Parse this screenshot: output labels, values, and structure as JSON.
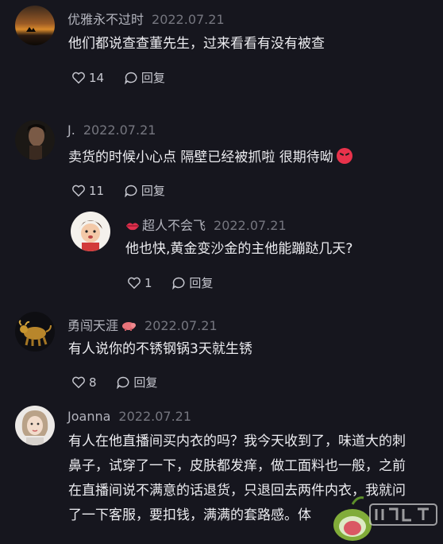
{
  "comments": [
    {
      "username": "优雅永不过时",
      "date": "2022.07.21",
      "text": "他们都说查查董先生，过来看看有没有被查",
      "likes": "14",
      "reply_label": "回复",
      "avatar_icon": "sunset-avatar"
    },
    {
      "username": "J.",
      "date": "2022.07.21",
      "text": "卖货的时候小心点 隔壁已经被抓啦 很期待呦",
      "emoji": "angry-face-emoji",
      "likes": "11",
      "reply_label": "回复",
      "avatar_icon": "person-avatar"
    },
    {
      "username": "超人不会飞",
      "username_prefix_icon": "lips-emoji",
      "date": "2022.07.21",
      "text": "他也快,黄金变沙金的主他能蹦跶几天?",
      "likes": "1",
      "reply_label": "回复",
      "avatar_icon": "baby-avatar"
    },
    {
      "username": "勇闯天涯",
      "username_suffix_icon": "pig-emoji",
      "date": "2022.07.21",
      "text": "有人说你的不锈钢锅3天就生锈",
      "likes": "8",
      "reply_label": "回复",
      "avatar_icon": "bull-avatar"
    },
    {
      "username": "Joanna",
      "date": "2022.07.21",
      "text_lines": [
        "有人在他直播间买内衣的吗？我今天收到了，味道大的刺",
        "鼻子，试穿了一下，皮肤都发痒，做工面料也一般，之前",
        "在直播间说不满意的话退货，只退回去两件内衣，我就问",
        "了一下客服，要扣钱，满满的套路感。体"
      ],
      "avatar_icon": "girl-avatar"
    }
  ],
  "colors": {
    "background": "#16161e",
    "username": "#b3b4bd",
    "date": "#75767f",
    "text": "#ececf0"
  }
}
